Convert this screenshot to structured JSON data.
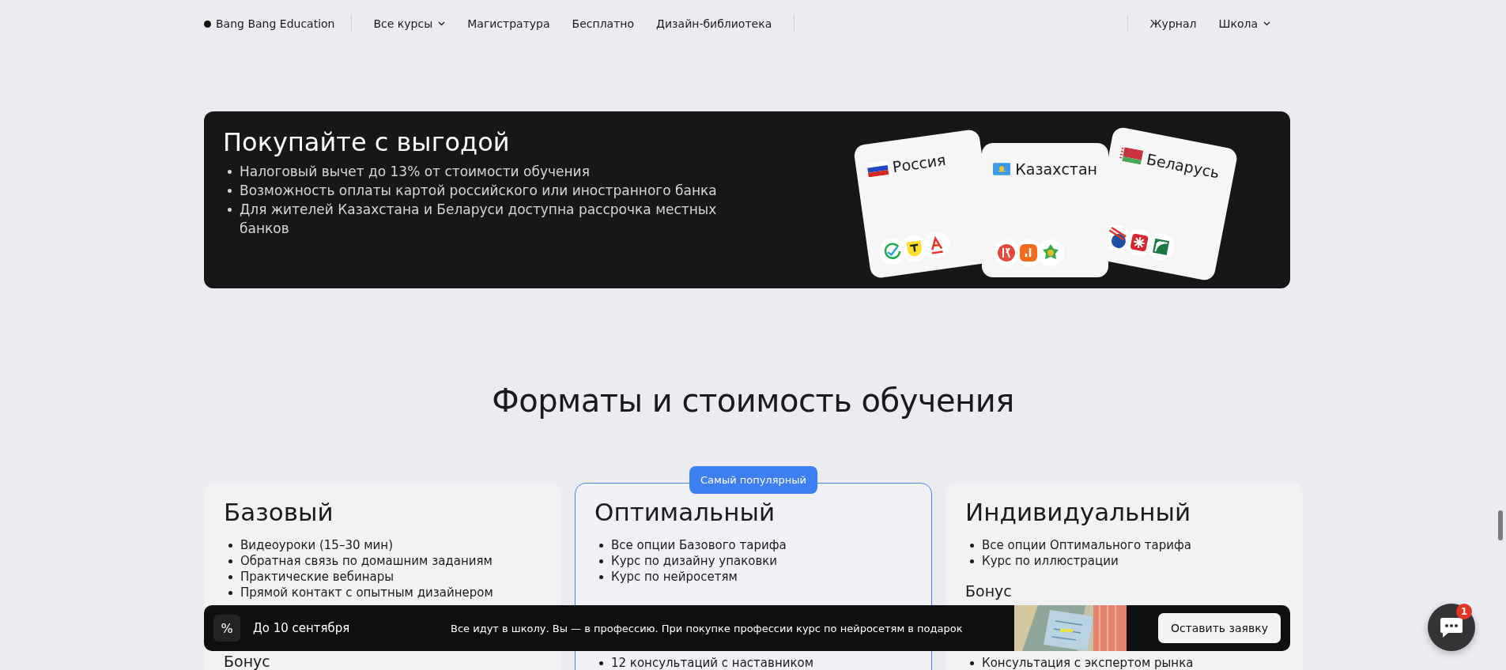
{
  "nav": {
    "logo": "Bang Bang Education",
    "items": [
      {
        "label": "Все курсы",
        "dropdown": true
      },
      {
        "label": "Магистратура",
        "dropdown": false
      },
      {
        "label": "Бесплатно",
        "dropdown": false
      },
      {
        "label": "Дизайн-библиотека",
        "dropdown": false
      }
    ],
    "right_items": [
      {
        "label": "Журнал",
        "dropdown": false
      },
      {
        "label": "Школа",
        "dropdown": true
      }
    ]
  },
  "promo": {
    "title": "Покупайте с выгодой",
    "points": [
      "Налоговый вычет до 13% от стоимости обучения",
      "Возможность оплаты картой российского или иностранного банка",
      "Для жителей Казахстана и Беларуси доступна рассрочка местных банков"
    ],
    "countries": [
      {
        "name": "Россия",
        "kind": "russia"
      },
      {
        "name": "Казахстан",
        "kind": "kazakhstan"
      },
      {
        "name": "Беларусь",
        "kind": "belarus"
      }
    ]
  },
  "pricing": {
    "title": "Форматы и стоимость обучения",
    "plans": [
      {
        "name": "Базовый",
        "highlighted": false,
        "features": [
          "Видеоуроки (15–30 мин)",
          "Обратная связь по домашним заданиям",
          "Практические вебинары",
          "Прямой контакт с опытным дизайнером"
        ],
        "extra_title": "Бонус"
      },
      {
        "name": "Оптимальный",
        "highlighted": true,
        "badge": "Самый популярный",
        "features": [
          "Все опции Базового тарифа",
          "Курс по дизайну упаковки",
          "Курс по нейросетям"
        ],
        "extra_items": [
          "12 консультаций с наставником"
        ]
      },
      {
        "name": "Индивидуальный",
        "highlighted": false,
        "features": [
          "Все опции Оптимального тарифа",
          "Курс по иллюстрации"
        ],
        "extra_title": "Бонус",
        "extra_items": [
          "Консультация с экспертом рынка"
        ]
      }
    ]
  },
  "offer_bar": {
    "icon": "%",
    "deadline": "До 10 сентября",
    "message": "Все идут в школу. Вы — в профессию. При покупке профессии курс по нейросетям в подарок",
    "button": "Оставить заявку"
  },
  "chat": {
    "unread": "1"
  }
}
